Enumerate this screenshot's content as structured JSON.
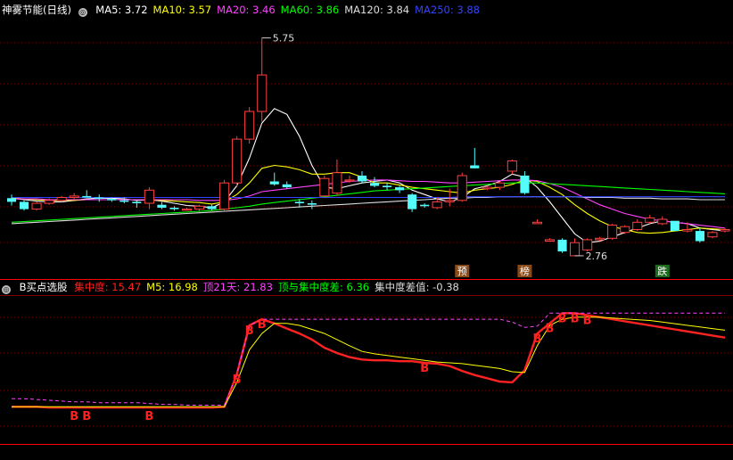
{
  "stock_title": "神雾节能(日线)",
  "ma_legend": [
    {
      "label": "MA5: 3.72",
      "color": "#ffffff"
    },
    {
      "label": "MA10: 3.57",
      "color": "#ffff00"
    },
    {
      "label": "MA20: 3.46",
      "color": "#ff44ff"
    },
    {
      "label": "MA60: 3.86",
      "color": "#00ff00"
    },
    {
      "label": "MA120: 3.84",
      "color": "#dddddd"
    },
    {
      "label": "MA250: 3.88",
      "color": "#3344ff"
    }
  ],
  "indicator_title": "B买点选股",
  "ind_legend": [
    {
      "label": "集中度: 15.47",
      "color": "#ff2222"
    },
    {
      "label": "M5: 16.98",
      "color": "#ffff00"
    },
    {
      "label": "顶21天: 21.83",
      "color": "#ff44ff"
    },
    {
      "label": "顶与集中度差: 6.36",
      "color": "#00ff00"
    },
    {
      "label": "集中度差值: -0.38",
      "color": "#dddddd"
    }
  ],
  "colors": {
    "up": "#ff4040",
    "down": "#54fcfc",
    "grid": "#7a0000",
    "frame": "#ff0000"
  },
  "annotations": {
    "high": "5.75",
    "low": "2.76"
  },
  "signal_labels": {
    "yu": "预",
    "bang": "榜",
    "die": "跌"
  },
  "buy_label": "B",
  "chart_data": {
    "type": "candlestick_with_indicator",
    "price_ylim": [
      2.6,
      6.0
    ],
    "candles": [
      [
        3.55,
        3.6,
        3.45,
        3.5
      ],
      [
        3.5,
        3.52,
        3.38,
        3.4
      ],
      [
        3.4,
        3.5,
        3.38,
        3.48
      ],
      [
        3.48,
        3.55,
        3.46,
        3.52
      ],
      [
        3.52,
        3.58,
        3.5,
        3.56
      ],
      [
        3.56,
        3.62,
        3.54,
        3.58
      ],
      [
        3.58,
        3.66,
        3.56,
        3.56
      ],
      [
        3.56,
        3.6,
        3.5,
        3.54
      ],
      [
        3.54,
        3.56,
        3.5,
        3.52
      ],
      [
        3.52,
        3.56,
        3.48,
        3.5
      ],
      [
        3.5,
        3.52,
        3.42,
        3.48
      ],
      [
        3.48,
        3.7,
        3.4,
        3.66
      ],
      [
        3.46,
        3.5,
        3.4,
        3.42
      ],
      [
        3.42,
        3.44,
        3.38,
        3.4
      ],
      [
        3.4,
        3.42,
        3.38,
        3.4
      ],
      [
        3.4,
        3.46,
        3.36,
        3.44
      ],
      [
        3.44,
        3.46,
        3.38,
        3.4
      ],
      [
        3.4,
        3.8,
        3.38,
        3.76
      ],
      [
        3.76,
        4.4,
        3.7,
        4.36
      ],
      [
        4.36,
        4.8,
        4.3,
        4.74
      ],
      [
        4.74,
        5.75,
        4.6,
        5.24
      ],
      [
        3.78,
        3.9,
        3.72,
        3.74
      ],
      [
        3.74,
        3.78,
        3.68,
        3.7
      ],
      [
        3.5,
        3.54,
        3.42,
        3.48
      ],
      [
        3.48,
        3.52,
        3.4,
        3.46
      ],
      [
        3.58,
        3.86,
        3.56,
        3.82
      ],
      [
        3.62,
        4.08,
        3.58,
        3.9
      ],
      [
        3.8,
        3.86,
        3.76,
        3.8
      ],
      [
        3.86,
        3.92,
        3.76,
        3.78
      ],
      [
        3.76,
        3.84,
        3.7,
        3.72
      ],
      [
        3.72,
        3.76,
        3.66,
        3.7
      ],
      [
        3.7,
        3.72,
        3.62,
        3.66
      ],
      [
        3.6,
        3.62,
        3.36,
        3.4
      ],
      [
        3.46,
        3.48,
        3.42,
        3.44
      ],
      [
        3.42,
        3.56,
        3.4,
        3.5
      ],
      [
        3.5,
        3.68,
        3.44,
        3.52
      ],
      [
        3.52,
        3.9,
        3.5,
        3.86
      ],
      [
        4.0,
        4.24,
        3.96,
        3.96
      ],
      [
        3.68,
        3.72,
        3.66,
        3.7
      ],
      [
        3.7,
        3.78,
        3.66,
        3.76
      ],
      [
        3.92,
        4.08,
        3.88,
        4.06
      ],
      [
        3.86,
        3.92,
        3.6,
        3.62
      ],
      [
        3.2,
        3.26,
        3.2,
        3.22
      ],
      [
        2.96,
        3.0,
        2.96,
        2.98
      ],
      [
        2.98,
        3.0,
        2.8,
        2.82
      ],
      [
        2.76,
        3.0,
        2.76,
        2.94
      ],
      [
        2.84,
        3.0,
        2.82,
        2.98
      ],
      [
        2.98,
        3.02,
        2.96,
        3.0
      ],
      [
        3.0,
        3.2,
        2.98,
        3.18
      ],
      [
        3.08,
        3.18,
        3.06,
        3.16
      ],
      [
        3.12,
        3.26,
        3.1,
        3.22
      ],
      [
        3.22,
        3.32,
        3.2,
        3.28
      ],
      [
        3.2,
        3.3,
        3.18,
        3.26
      ],
      [
        3.24,
        3.2,
        3.2,
        3.1
      ],
      [
        3.1,
        3.22,
        3.08,
        3.12
      ],
      [
        3.1,
        3.14,
        2.94,
        2.96
      ],
      [
        3.02,
        3.1,
        3.0,
        3.08
      ],
      [
        3.1,
        3.14,
        3.08,
        3.12
      ]
    ],
    "ma_series": [
      {
        "name": "MA5",
        "color": "#ffffff",
        "values": [
          3.55,
          3.53,
          3.51,
          3.5,
          3.5,
          3.52,
          3.54,
          3.55,
          3.55,
          3.54,
          3.52,
          3.53,
          3.51,
          3.48,
          3.45,
          3.44,
          3.42,
          3.5,
          3.72,
          4.1,
          4.58,
          4.78,
          4.7,
          4.4,
          4.0,
          3.7,
          3.68,
          3.72,
          3.76,
          3.78,
          3.8,
          3.76,
          3.66,
          3.6,
          3.54,
          3.5,
          3.56,
          3.68,
          3.72,
          3.78,
          3.88,
          3.84,
          3.7,
          3.5,
          3.28,
          3.06,
          2.94,
          2.96,
          3.02,
          3.08,
          3.14,
          3.2,
          3.24,
          3.22,
          3.2,
          3.14,
          3.12,
          3.1
        ]
      },
      {
        "name": "MA10",
        "color": "#ffff00",
        "values": [
          3.55,
          3.54,
          3.53,
          3.52,
          3.52,
          3.52,
          3.53,
          3.53,
          3.53,
          3.53,
          3.53,
          3.53,
          3.52,
          3.51,
          3.5,
          3.49,
          3.47,
          3.5,
          3.6,
          3.76,
          3.96,
          4.0,
          3.98,
          3.94,
          3.88,
          3.88,
          3.9,
          3.9,
          3.84,
          3.76,
          3.76,
          3.73,
          3.7,
          3.68,
          3.66,
          3.64,
          3.62,
          3.66,
          3.68,
          3.7,
          3.74,
          3.8,
          3.78,
          3.7,
          3.6,
          3.46,
          3.34,
          3.24,
          3.16,
          3.12,
          3.08,
          3.07,
          3.08,
          3.1,
          3.12,
          3.14,
          3.13,
          3.12
        ]
      },
      {
        "name": "MA20",
        "color": "#ff44ff",
        "values": [
          3.54,
          3.54,
          3.54,
          3.53,
          3.53,
          3.53,
          3.53,
          3.53,
          3.53,
          3.53,
          3.53,
          3.53,
          3.53,
          3.53,
          3.53,
          3.52,
          3.52,
          3.52,
          3.54,
          3.58,
          3.64,
          3.66,
          3.68,
          3.7,
          3.72,
          3.74,
          3.76,
          3.78,
          3.79,
          3.8,
          3.8,
          3.79,
          3.78,
          3.78,
          3.77,
          3.76,
          3.76,
          3.77,
          3.78,
          3.79,
          3.8,
          3.8,
          3.79,
          3.75,
          3.7,
          3.62,
          3.54,
          3.46,
          3.4,
          3.34,
          3.3,
          3.26,
          3.24,
          3.22,
          3.2,
          3.18,
          3.16,
          3.14
        ]
      },
      {
        "name": "MA60",
        "color": "#00ff00",
        "values": [
          3.22,
          3.23,
          3.24,
          3.25,
          3.26,
          3.27,
          3.28,
          3.29,
          3.3,
          3.31,
          3.32,
          3.33,
          3.34,
          3.35,
          3.36,
          3.37,
          3.38,
          3.4,
          3.42,
          3.44,
          3.47,
          3.49,
          3.51,
          3.53,
          3.55,
          3.57,
          3.59,
          3.61,
          3.63,
          3.65,
          3.66,
          3.67,
          3.68,
          3.69,
          3.7,
          3.71,
          3.72,
          3.73,
          3.74,
          3.75,
          3.76,
          3.76,
          3.76,
          3.75,
          3.74,
          3.73,
          3.72,
          3.71,
          3.7,
          3.69,
          3.68,
          3.67,
          3.66,
          3.65,
          3.64,
          3.63,
          3.62,
          3.61
        ]
      },
      {
        "name": "MA120",
        "color": "#dddddd",
        "values": [
          3.2,
          3.21,
          3.22,
          3.23,
          3.24,
          3.25,
          3.26,
          3.27,
          3.28,
          3.29,
          3.3,
          3.31,
          3.32,
          3.33,
          3.34,
          3.35,
          3.36,
          3.37,
          3.38,
          3.39,
          3.4,
          3.41,
          3.42,
          3.43,
          3.44,
          3.45,
          3.46,
          3.47,
          3.48,
          3.49,
          3.5,
          3.51,
          3.52,
          3.53,
          3.54,
          3.55,
          3.55,
          3.56,
          3.56,
          3.57,
          3.57,
          3.57,
          3.57,
          3.57,
          3.57,
          3.57,
          3.56,
          3.56,
          3.56,
          3.55,
          3.55,
          3.55,
          3.54,
          3.54,
          3.54,
          3.53,
          3.53,
          3.53
        ]
      },
      {
        "name": "MA250",
        "color": "#3344ff",
        "values": [
          3.56,
          3.56,
          3.56,
          3.56,
          3.56,
          3.56,
          3.56,
          3.56,
          3.56,
          3.56,
          3.56,
          3.56,
          3.56,
          3.56,
          3.56,
          3.56,
          3.56,
          3.56,
          3.56,
          3.56,
          3.56,
          3.56,
          3.56,
          3.56,
          3.56,
          3.56,
          3.56,
          3.56,
          3.56,
          3.56,
          3.56,
          3.56,
          3.56,
          3.56,
          3.56,
          3.56,
          3.57,
          3.57,
          3.57,
          3.57,
          3.57,
          3.57,
          3.57,
          3.57,
          3.57,
          3.57,
          3.57,
          3.57,
          3.57,
          3.57,
          3.57,
          3.57,
          3.57,
          3.57,
          3.57,
          3.57,
          3.57,
          3.57
        ]
      }
    ],
    "indicator_ylim": [
      0,
      30
    ],
    "indicator_series": [
      {
        "name": "集中度",
        "color": "#ff2222",
        "values": [
          3,
          3,
          3,
          2.8,
          2.8,
          2.8,
          2.8,
          2.8,
          2.8,
          2.8,
          2.8,
          2.8,
          2.8,
          2.8,
          2.8,
          2.8,
          2.8,
          3,
          11,
          23,
          24.5,
          23.5,
          22.2,
          21,
          19.5,
          17.5,
          16.2,
          15.2,
          14.6,
          14.4,
          14.4,
          14.2,
          14.2,
          13.8,
          13.6,
          13,
          11.8,
          10.8,
          10,
          9.2,
          9,
          12,
          21,
          23.5,
          26,
          26,
          25.5,
          25,
          24.5,
          24,
          23.5,
          23,
          22.5,
          22,
          21.5,
          21,
          20.5,
          20
        ]
      },
      {
        "name": "M5",
        "color": "#ffff00",
        "values": [
          3,
          3,
          3,
          3,
          3,
          3,
          3,
          3,
          3,
          3,
          3,
          3,
          3,
          3,
          3,
          3,
          3,
          3,
          9,
          17,
          21,
          23.5,
          23.5,
          23,
          22,
          21,
          19.5,
          18,
          16.6,
          16,
          15.6,
          15.2,
          14.8,
          14.4,
          14,
          13.8,
          13.6,
          13.2,
          12.8,
          12.4,
          11.6,
          11.4,
          18,
          23,
          24.5,
          25,
          25,
          25,
          24.8,
          24.6,
          24.4,
          24.2,
          23.8,
          23.4,
          23,
          22.6,
          22.2,
          21.8
        ]
      },
      {
        "name": "顶21天",
        "color": "#ff44ff",
        "dashed": true,
        "values": [
          5,
          5,
          4.8,
          4.6,
          4.4,
          4.2,
          4.2,
          4,
          4,
          4,
          4,
          3.8,
          3.6,
          3.6,
          3.4,
          3.4,
          3.4,
          3.4,
          11,
          23,
          24.5,
          24.5,
          24.5,
          24.5,
          24.5,
          24.5,
          24.5,
          24.5,
          24.5,
          24.5,
          24.5,
          24.5,
          24.5,
          24.5,
          24.5,
          24.5,
          24.5,
          24.5,
          24.5,
          24.5,
          23.8,
          22.5,
          22.8,
          26,
          26,
          26,
          26,
          26,
          26,
          26,
          26,
          26,
          26,
          26,
          26,
          26,
          26,
          26
        ]
      }
    ],
    "buy_points": [
      5,
      6,
      11,
      18,
      19,
      20,
      33,
      42,
      43,
      44,
      45,
      46
    ]
  }
}
